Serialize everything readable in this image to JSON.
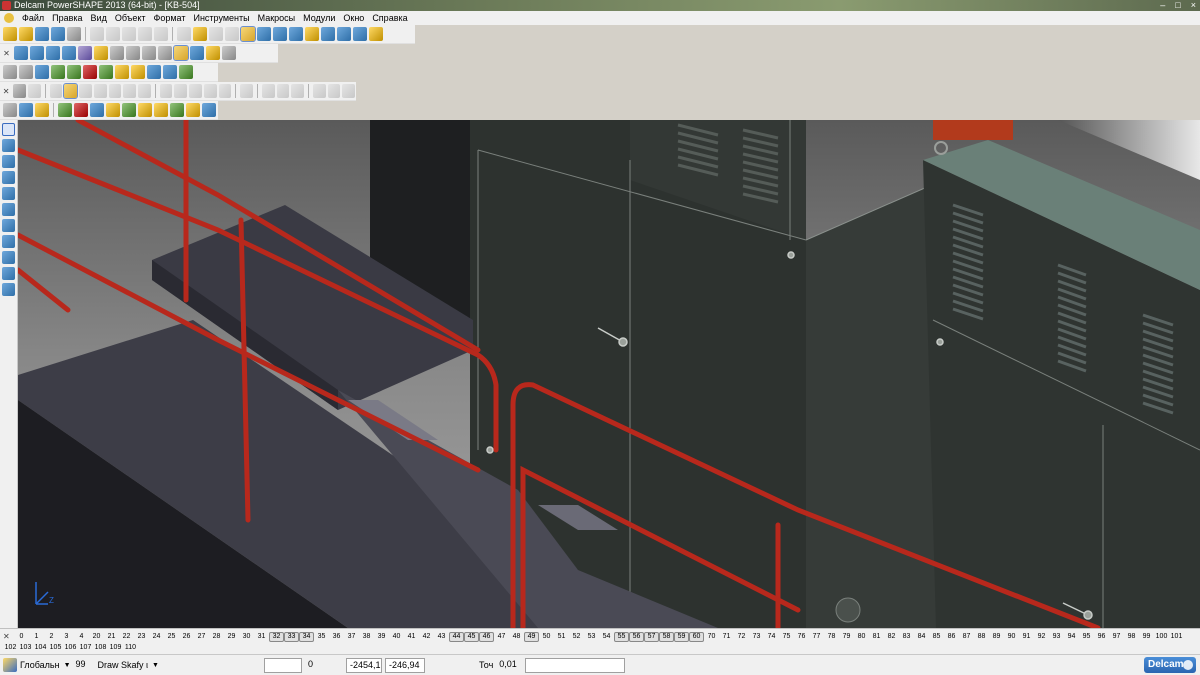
{
  "window": {
    "title": "Delcam PowerSHAPE 2013 (64-bit) - [KB-504]"
  },
  "menu": {
    "items": [
      "Файл",
      "Правка",
      "Вид",
      "Объект",
      "Формат",
      "Инструменты",
      "Макросы",
      "Модули",
      "Окно",
      "Справка"
    ]
  },
  "levels": {
    "row1": [
      "0",
      "1",
      "2",
      "3",
      "4",
      "20",
      "21",
      "22",
      "23",
      "24",
      "25",
      "26",
      "27",
      "28",
      "29",
      "30",
      "31",
      "32",
      "33",
      "34",
      "35",
      "36",
      "37",
      "38",
      "39",
      "40",
      "41",
      "42",
      "43",
      "44",
      "45",
      "46",
      "47",
      "48",
      "49",
      "50",
      "51",
      "52",
      "53",
      "54",
      "55",
      "56",
      "57",
      "58",
      "59",
      "60",
      "70",
      "71",
      "72",
      "73",
      "74",
      "75",
      "76",
      "77",
      "78",
      "79",
      "80",
      "81",
      "82",
      "83",
      "84",
      "85",
      "86",
      "87",
      "88",
      "89",
      "90",
      "91",
      "92",
      "93",
      "94",
      "95",
      "96",
      "97",
      "98",
      "99",
      "100",
      "101"
    ],
    "row2": [
      "102",
      "103",
      "104",
      "105",
      "106",
      "107",
      "108",
      "109",
      "110"
    ],
    "active": [
      "32",
      "33",
      "34",
      "44",
      "45",
      "46",
      "49",
      "55",
      "56",
      "57",
      "58",
      "59",
      "60"
    ]
  },
  "status": {
    "workplane": "Глобальн",
    "level_number": "99",
    "level_name": "Draw Skafy ι",
    "coord_a": "0",
    "coord_x": "-2454,1",
    "coord_y": "-246,94",
    "tolerance_label": "Точ",
    "tolerance_value": "0,01"
  },
  "brand": {
    "label": "Delcam"
  },
  "viewport": {
    "axis_label": "Z",
    "colors": {
      "railing": "#b8281c",
      "cabinet": "#2e3330",
      "platform": "#3b3b44",
      "background": "#6d6d6d"
    }
  }
}
